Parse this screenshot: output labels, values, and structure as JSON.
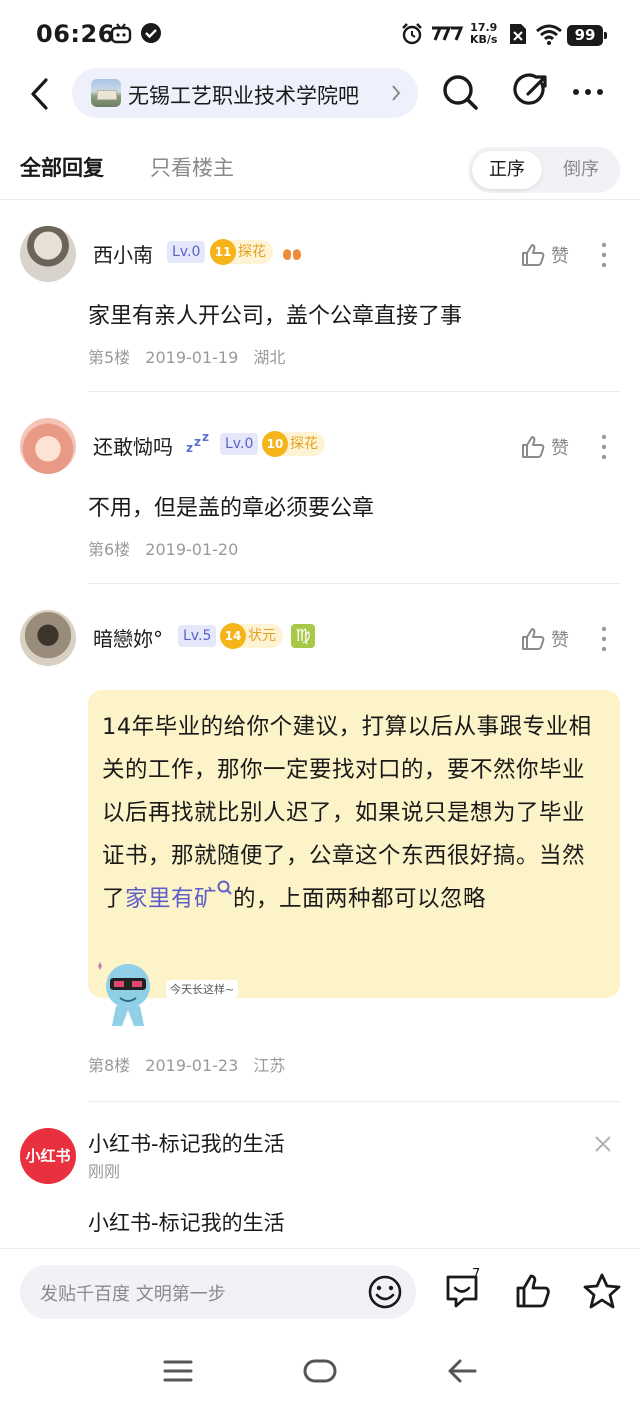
{
  "status_bar": {
    "time": "06:26",
    "net_speed_value": "17.9",
    "net_speed_unit": "KB/s",
    "battery": "99"
  },
  "nav": {
    "forum_name": "无锡工艺职业技术学院吧"
  },
  "tabs": {
    "all_replies": "全部回复",
    "op_only": "只看楼主",
    "order_asc": "正序",
    "order_desc": "倒序"
  },
  "replies": [
    {
      "username": "西小南",
      "level": "Lv.0",
      "badge_num": "11",
      "badge_label": "探花",
      "content": "家里有亲人开公司，盖个公章直接了事",
      "floor": "第5楼",
      "date": "2019-01-19",
      "location": "湖北",
      "like_label": "赞"
    },
    {
      "username": "还敢恸吗",
      "level": "Lv.0",
      "badge_num": "10",
      "badge_label": "探花",
      "content": "不用，但是盖的章必须要公章",
      "floor": "第6楼",
      "date": "2019-01-20",
      "location": "",
      "like_label": "赞"
    },
    {
      "username": "暗戀妳°",
      "level": "Lv.5",
      "badge_num": "14",
      "badge_label": "状元",
      "zodiac": "♍",
      "content_before_link": "14年毕业的给你个建议，打算以后从事跟专业相关的工作，那你一定要找对口的，要不然你毕业以后再找就比别人迟了，如果说只是想为了毕业证书，那就随便了，公章这个东西很好搞。当然了",
      "content_link": "家里有矿",
      "content_after_link": "的，上面两种都可以忽略",
      "sticker_caption": "今天长这样~",
      "floor": "第8楼",
      "date": "2019-01-23",
      "location": "江苏",
      "like_label": "赞"
    }
  ],
  "ad": {
    "logo_text": "小红书",
    "title": "小红书-标记我的生活",
    "time": "刚刚",
    "body": "小红书-标记我的生活"
  },
  "bottom_bar": {
    "compose_placeholder": "发贴千百度 文明第一步",
    "comment_count": "7"
  },
  "colors": {
    "accent": "#5b5fc7",
    "bubble_bg": "#fdf3c8",
    "badge_gold": "#f4b41a",
    "ad_red": "#e8303f"
  }
}
